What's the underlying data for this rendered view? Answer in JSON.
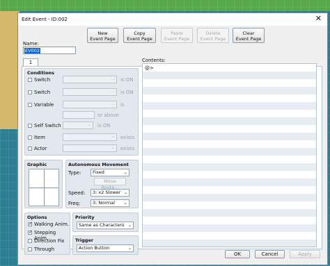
{
  "window": {
    "title": "Edit Event - ID:002",
    "close_glyph": "✕"
  },
  "name": {
    "label": "Name:",
    "value": "EV002"
  },
  "toolbar": {
    "new_line1": "New",
    "new_line2": "Event Page",
    "copy_line1": "Copy",
    "copy_line2": "Event Page",
    "paste_line1": "Paste",
    "paste_line2": "Event Page",
    "delete_line1": "Delete",
    "delete_line2": "Event Page",
    "clear_line1": "Clear",
    "clear_line2": "Event Page"
  },
  "tabs": [
    {
      "label": "1"
    }
  ],
  "conditions": {
    "title": "Conditions",
    "switch1": {
      "label": "Switch",
      "suffix": "is ON"
    },
    "switch2": {
      "label": "Switch",
      "suffix": "is ON"
    },
    "variable": {
      "label": "Variable",
      "suffix": "is",
      "value_suffix": "or above"
    },
    "self_switch": {
      "label": "Self Switch",
      "suffix": "is ON"
    },
    "item": {
      "label": "Item",
      "suffix": "exists"
    },
    "actor": {
      "label": "Actor",
      "suffix": "exists"
    },
    "dropdown_glyph": "⌄",
    "ellipsis": "..."
  },
  "graphic": {
    "title": "Graphic"
  },
  "autonomous": {
    "title": "Autonomous Movement",
    "type_label": "Type:",
    "type_value": "Fixed",
    "move_route": "Move Route...",
    "speed_label": "Speed:",
    "speed_value": "3: x2 Slower",
    "freq_label": "Freq:",
    "freq_value": "3: Normal"
  },
  "options": {
    "title": "Options",
    "walking": {
      "label": "Walking Anim.",
      "checked": true
    },
    "stepping": {
      "label": "Stepping Anim.",
      "checked": true
    },
    "direction_fix": {
      "label": "Direction Fix",
      "checked": false
    },
    "through": {
      "label": "Through",
      "checked": false
    }
  },
  "priority": {
    "title": "Priority",
    "value": "Same as Characters"
  },
  "trigger": {
    "title": "Trigger",
    "value": "Action Button"
  },
  "contents": {
    "label": "Contents:",
    "first_line": "@>"
  },
  "dialog": {
    "ok": "OK",
    "cancel": "Cancel",
    "apply": "Apply"
  }
}
